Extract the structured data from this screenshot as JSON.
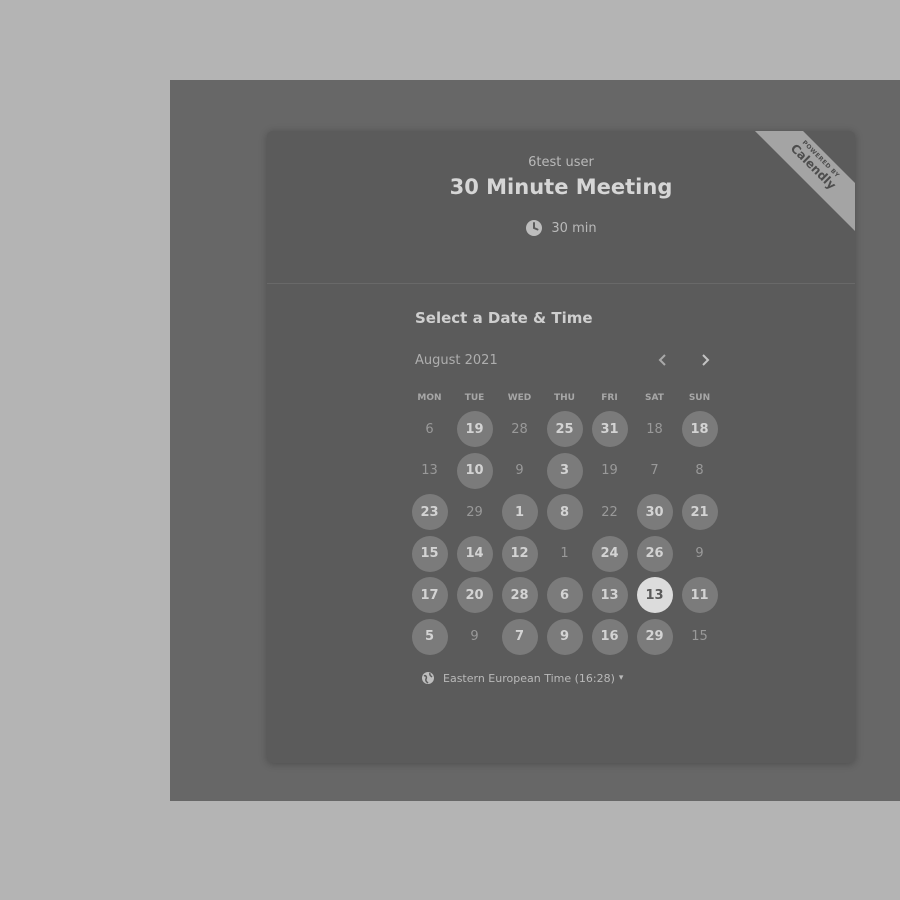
{
  "event": {
    "organizer": "6test user",
    "title": "30 Minute Meeting",
    "duration": "30 min"
  },
  "badge": {
    "line1": "POWERED BY",
    "line2": "Calendly"
  },
  "calendar": {
    "heading": "Select a Date & Time",
    "month": "August 2021",
    "prev_icon": "chevron-left-icon",
    "next_icon": "chevron-right-icon",
    "weekdays": [
      "MON",
      "TUE",
      "WED",
      "THU",
      "FRI",
      "SAT",
      "SUN"
    ],
    "days": [
      {
        "label": "6",
        "state": "unavailable"
      },
      {
        "label": "19",
        "state": "available"
      },
      {
        "label": "28",
        "state": "unavailable"
      },
      {
        "label": "25",
        "state": "available"
      },
      {
        "label": "31",
        "state": "available"
      },
      {
        "label": "18",
        "state": "unavailable"
      },
      {
        "label": "18",
        "state": "available"
      },
      {
        "label": "13",
        "state": "unavailable"
      },
      {
        "label": "10",
        "state": "available"
      },
      {
        "label": "9",
        "state": "unavailable"
      },
      {
        "label": "3",
        "state": "available"
      },
      {
        "label": "19",
        "state": "unavailable"
      },
      {
        "label": "7",
        "state": "unavailable"
      },
      {
        "label": "8",
        "state": "unavailable"
      },
      {
        "label": "23",
        "state": "available"
      },
      {
        "label": "29",
        "state": "unavailable"
      },
      {
        "label": "1",
        "state": "available"
      },
      {
        "label": "8",
        "state": "available"
      },
      {
        "label": "22",
        "state": "unavailable"
      },
      {
        "label": "30",
        "state": "available"
      },
      {
        "label": "21",
        "state": "available"
      },
      {
        "label": "15",
        "state": "available"
      },
      {
        "label": "14",
        "state": "available"
      },
      {
        "label": "12",
        "state": "available"
      },
      {
        "label": "1",
        "state": "unavailable"
      },
      {
        "label": "24",
        "state": "available"
      },
      {
        "label": "26",
        "state": "available"
      },
      {
        "label": "9",
        "state": "unavailable"
      },
      {
        "label": "17",
        "state": "available"
      },
      {
        "label": "20",
        "state": "available"
      },
      {
        "label": "28",
        "state": "available"
      },
      {
        "label": "6",
        "state": "available"
      },
      {
        "label": "13",
        "state": "available"
      },
      {
        "label": "13",
        "state": "selected"
      },
      {
        "label": "11",
        "state": "available"
      },
      {
        "label": "5",
        "state": "available"
      },
      {
        "label": "9",
        "state": "unavailable"
      },
      {
        "label": "7",
        "state": "available"
      },
      {
        "label": "9",
        "state": "available"
      },
      {
        "label": "16",
        "state": "available"
      },
      {
        "label": "29",
        "state": "available"
      },
      {
        "label": "15",
        "state": "unavailable"
      }
    ]
  },
  "timezone": {
    "icon": "globe-icon",
    "label": "Eastern European Time (16:28)",
    "caret": "▾"
  },
  "colors": {
    "page_background": "#b4b4b4",
    "overlay": "#676767",
    "card": "#5b5b5b",
    "day_available": "#7b7b7b",
    "day_selected": "#dcdcdc"
  }
}
